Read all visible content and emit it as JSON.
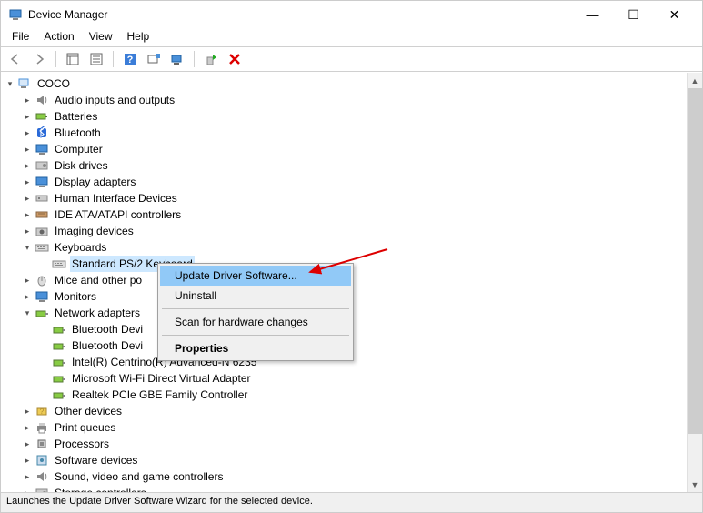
{
  "window": {
    "title": "Device Manager"
  },
  "menu": {
    "file": "File",
    "action": "Action",
    "view": "View",
    "help": "Help"
  },
  "tree": {
    "root": "COCO",
    "items": [
      "Audio inputs and outputs",
      "Batteries",
      "Bluetooth",
      "Computer",
      "Disk drives",
      "Display adapters",
      "Human Interface Devices",
      "IDE ATA/ATAPI controllers",
      "Imaging devices",
      "Keyboards",
      "Mice and other po",
      "Monitors",
      "Network adapters",
      "Other devices",
      "Print queues",
      "Processors",
      "Software devices",
      "Sound, video and game controllers",
      "Storage controllers"
    ],
    "keyboard_child": "Standard PS/2 Keyboard",
    "network_children": [
      "Bluetooth Devi",
      "Bluetooth Devi",
      "Intel(R) Centrino(R) Advanced-N 6235",
      "Microsoft Wi-Fi Direct Virtual Adapter",
      "Realtek PCIe GBE Family Controller"
    ]
  },
  "context_menu": {
    "update": "Update Driver Software...",
    "uninstall": "Uninstall",
    "scan": "Scan for hardware changes",
    "properties": "Properties"
  },
  "status": "Launches the Update Driver Software Wizard for the selected device."
}
